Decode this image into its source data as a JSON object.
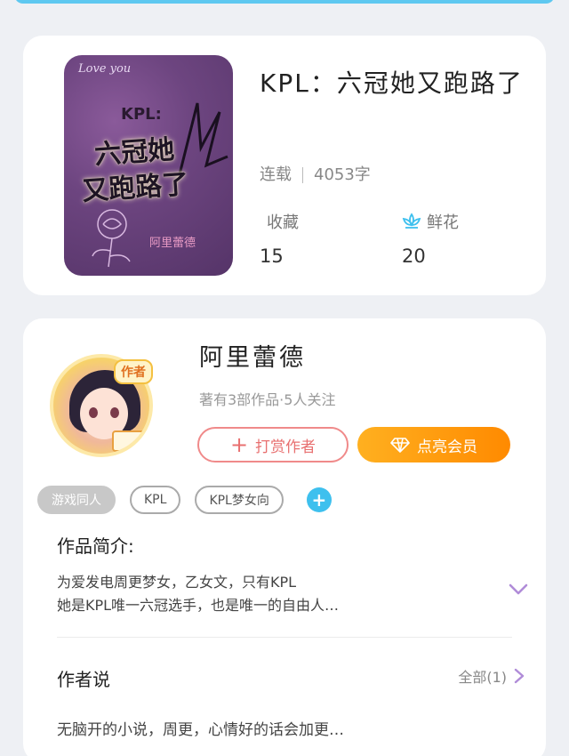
{
  "book": {
    "cover": {
      "love_text": "Love you",
      "kpl_text": "KPL:",
      "title_line1": "六冠她",
      "title_line2": "又跑路了",
      "penname": "阿里蕾德"
    },
    "title": "KPL：六冠她又跑路了",
    "status": "连载",
    "word_count": "4053字",
    "favorites_label": "收藏",
    "favorites_value": "15",
    "flowers_label": "鲜花",
    "flowers_value": "20",
    "flower_icon": "lotus-icon"
  },
  "author": {
    "tag": "作者",
    "name": "阿里蕾德",
    "subtitle": "著有3部作品·5人关注",
    "reward_label": "打赏作者",
    "vip_label": "点亮会员",
    "tags": [
      "游戏同人",
      "KPL",
      "KPL梦女向"
    ],
    "add_tag": "+"
  },
  "intro": {
    "title": "作品简介:",
    "line1": "为爱发电周更梦女，乙女文，只有KPL",
    "line2": "她是KPL唯一六冠选手，也是唯一的自由人…"
  },
  "author_say": {
    "title": "作者说",
    "all_label": "全部(1)",
    "text": "无脑开的小说，周更，心情好的话会加更…"
  },
  "colors": {
    "accent_blue": "#3ec0ee",
    "vip_orange": "#ff8a00",
    "reward_red": "#e87070"
  }
}
